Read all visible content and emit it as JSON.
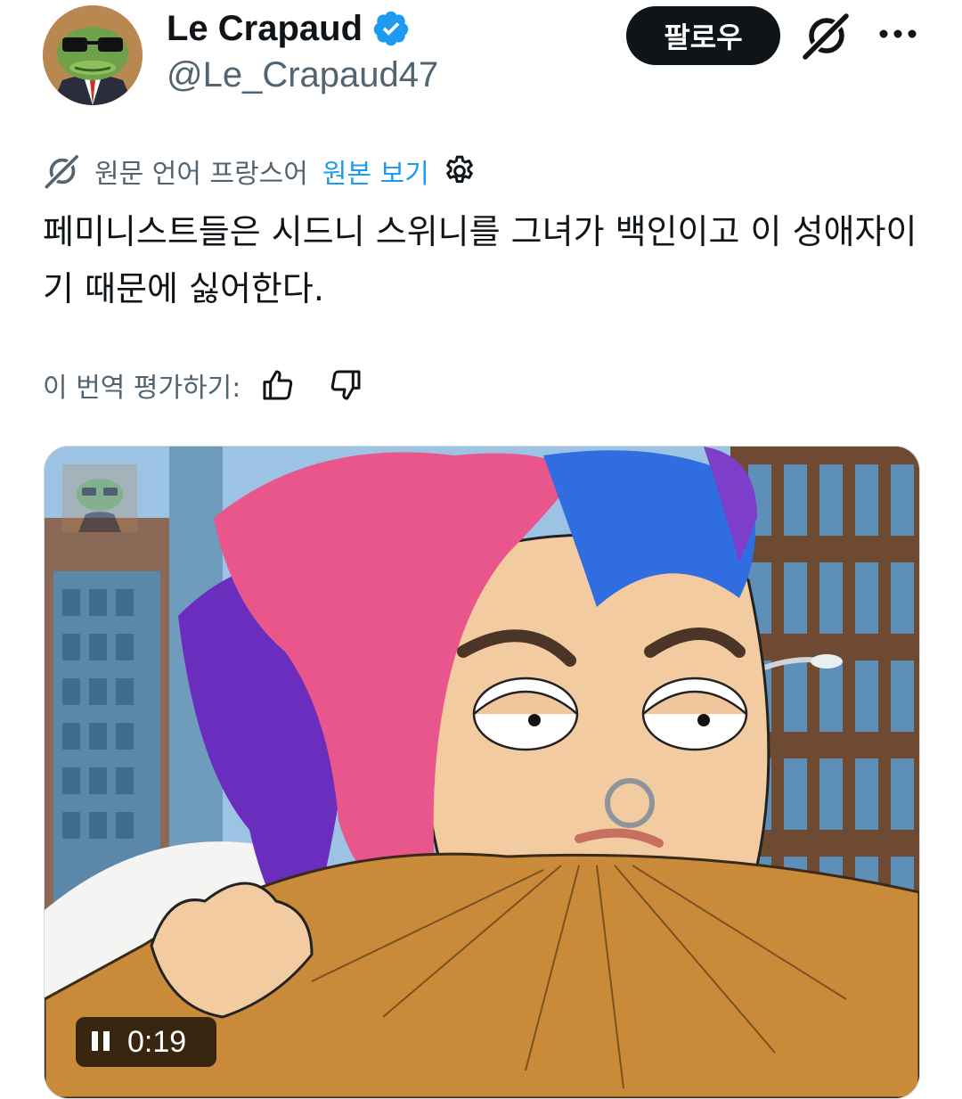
{
  "author": {
    "display_name": "Le Crapaud",
    "handle": "@Le_Crapaud47",
    "verified": true
  },
  "header": {
    "follow_label": "팔로우",
    "icons": [
      "grok-icon",
      "more-icon"
    ]
  },
  "translation": {
    "label": "원문 언어 프랑스어",
    "show_original": "원본 보기",
    "text": "페미니스트들은 시드니 스위니를 그녀가 백인이고 이 성애자이기 때문에 싫어한다.",
    "rate_label": "이 번역 평가하기:"
  },
  "media": {
    "type": "video",
    "time": "0:19",
    "state": "playing"
  },
  "colors": {
    "link": "#1d9bf0",
    "secondary": "#536471",
    "verified": "#1d9bf0",
    "primary_text": "#0f1419"
  }
}
